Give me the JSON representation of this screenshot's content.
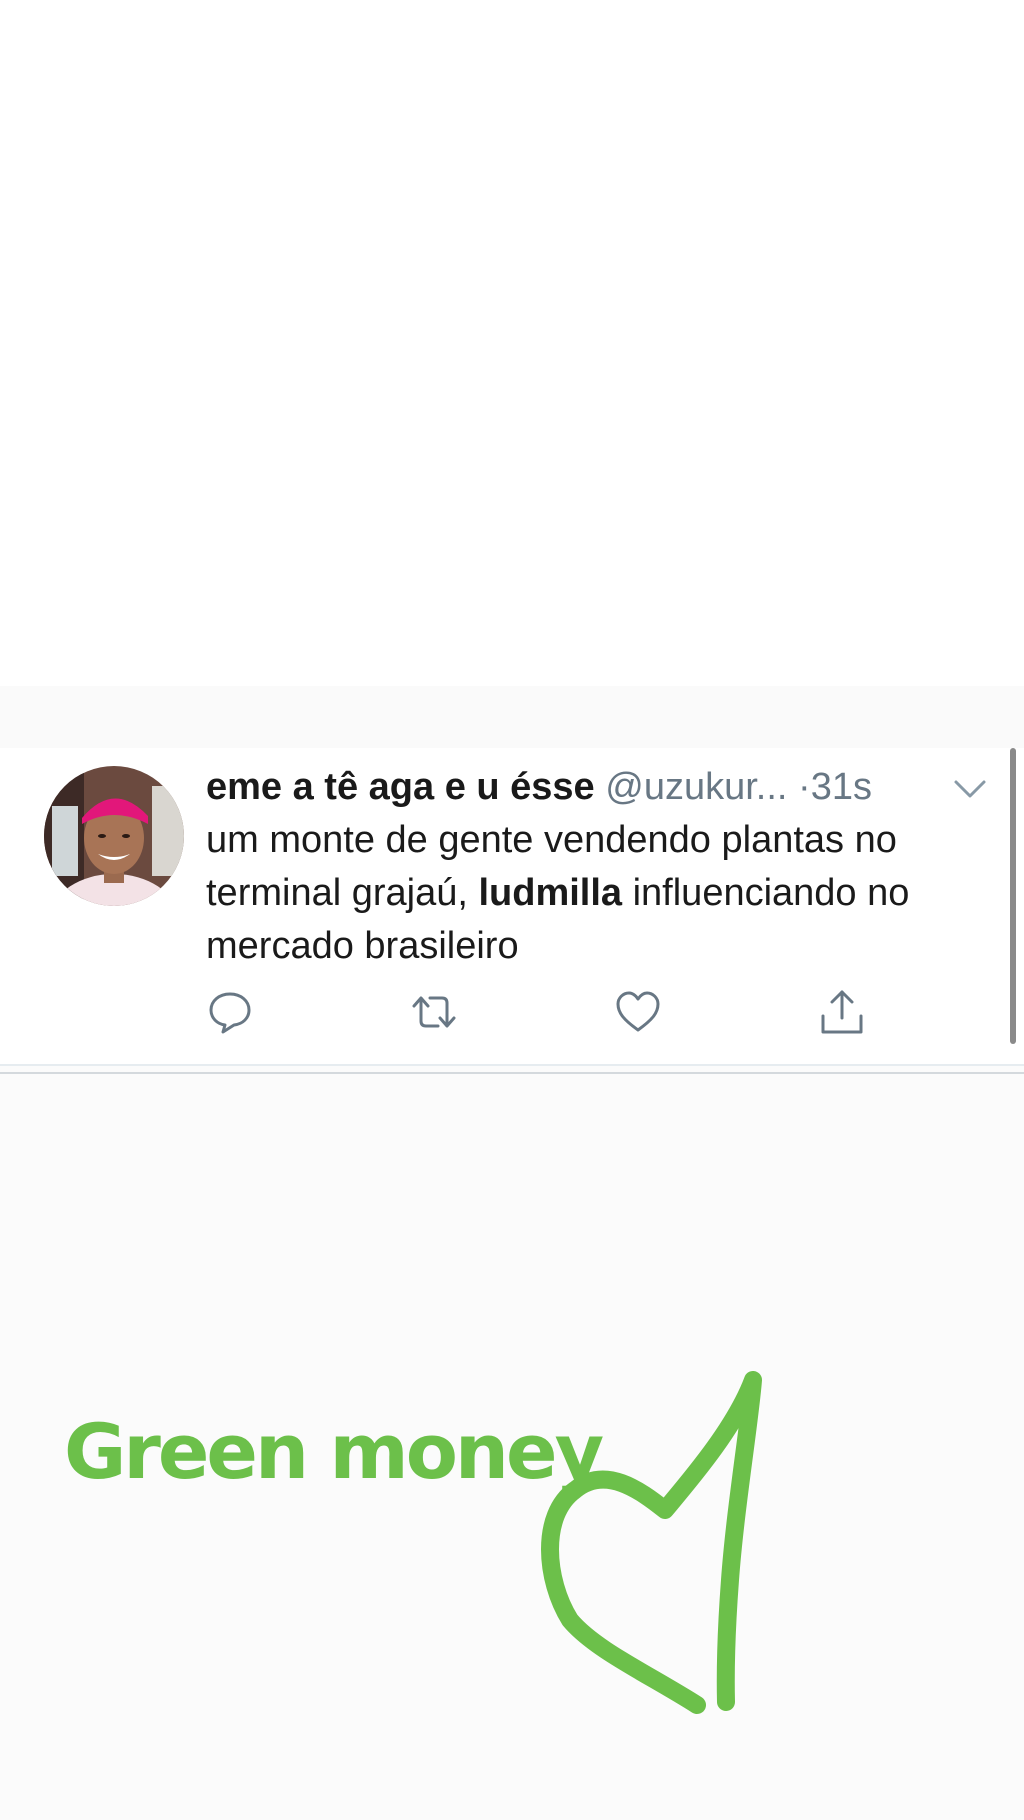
{
  "tweet": {
    "display_name": "eme a tê aga e u ésse",
    "handle": "@uzukur...",
    "separator": "·",
    "time": "31s",
    "text_before": "um monte de gente vendendo plantas no terminal grajaú,",
    "mention": "ludmilla",
    "text_after": "influenciando no mercado brasileiro",
    "actions": [
      {
        "name": "reply",
        "icon": "speech-bubble-icon"
      },
      {
        "name": "retweet",
        "icon": "retweet-arrows-icon"
      },
      {
        "name": "like",
        "icon": "heart-icon"
      },
      {
        "name": "share",
        "icon": "share-upload-icon"
      }
    ]
  },
  "sticker": {
    "text": "Green money",
    "color": "#6cc04a"
  },
  "colors": {
    "text": "#1a1a1a",
    "secondary": "#687784",
    "sticker_green": "#6cc04a"
  }
}
